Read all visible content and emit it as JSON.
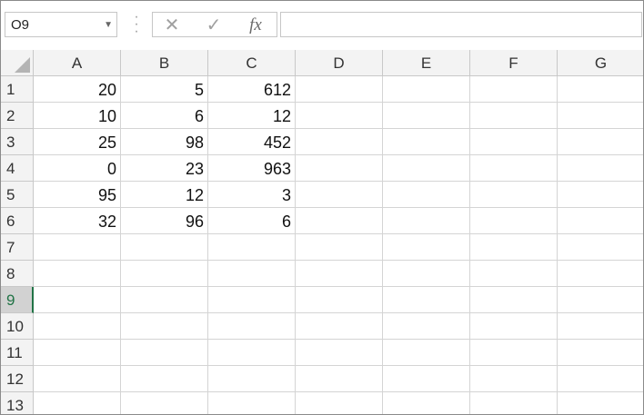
{
  "formula_bar": {
    "name_box": "O9",
    "cancel_glyph": "✕",
    "enter_glyph": "✓",
    "function_label": "fx",
    "formula": ""
  },
  "columns": [
    "A",
    "B",
    "C",
    "D",
    "E",
    "F",
    "G"
  ],
  "rows": [
    "1",
    "2",
    "3",
    "4",
    "5",
    "6",
    "7",
    "8",
    "9",
    "10",
    "11",
    "12",
    "13"
  ],
  "active_row": "9",
  "cells": [
    [
      "20",
      "5",
      "612"
    ],
    [
      "10",
      "6",
      "12"
    ],
    [
      "25",
      "98",
      "452"
    ],
    [
      "0",
      "23",
      "963"
    ],
    [
      "95",
      "12",
      "3"
    ],
    [
      "32",
      "96",
      "6"
    ]
  ],
  "colors": {
    "accent": "#217346",
    "header_bg": "#f3f3f3",
    "gridline": "#d4d4d4"
  }
}
